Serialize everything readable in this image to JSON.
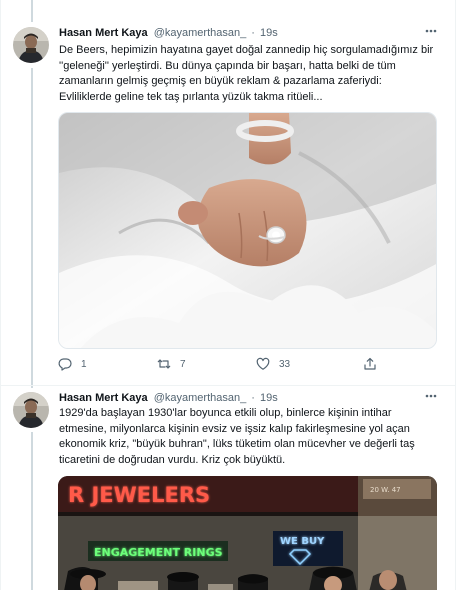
{
  "tweets": [
    {
      "author_name": "Hasan Mert Kaya",
      "handle": "@kayamerthasan_",
      "separator": "·",
      "time": "19s",
      "more_icon": "more-icon",
      "lines": [
        "De Beers, hepimizin hayatına gayet doğal zannedip hiç sorgulamadığımız bir",
        "''geleneği'' yerleştirdi. Bu dünya çapında bir başarı, hatta belki de tüm",
        "zamanların gelmiş geçmiş en büyük reklam & pazarlama zaferiydi:",
        "Evliliklerde geline tek taş pırlanta yüzük takma ritüeli..."
      ],
      "actions": {
        "reply_count": "1",
        "retweet_count": "7",
        "like_count": "33"
      }
    },
    {
      "author_name": "Hasan Mert Kaya",
      "handle": "@kayamerthasan_",
      "separator": "·",
      "time": "19s",
      "more_icon": "more-icon",
      "lines": [
        "1929'da başlayan 1930'lar boyunca etkili olup, binlerce kişinin intihar",
        "etmesine, milyonlarca kişinin evsiz ve işsiz kalıp fakirleşmesine yol açan",
        "ekonomik kriz,  \"büyük buhran\", lüks tüketim olan mücevher ve değerli taş",
        "ticaretini de doğrudan vurdu. Kriz çok büyüktü."
      ],
      "media": {
        "sign_jewelers": "R JEWELERS",
        "sign_rings": "ENGAGEMENT RINGS",
        "sign_buy": "WE BUY",
        "sign_address": "20 W. 47"
      }
    }
  ],
  "colors": {
    "text": "#0f1419",
    "secondary": "#536471",
    "border": "#eff3f4",
    "thread_line": "#cfd9de"
  }
}
